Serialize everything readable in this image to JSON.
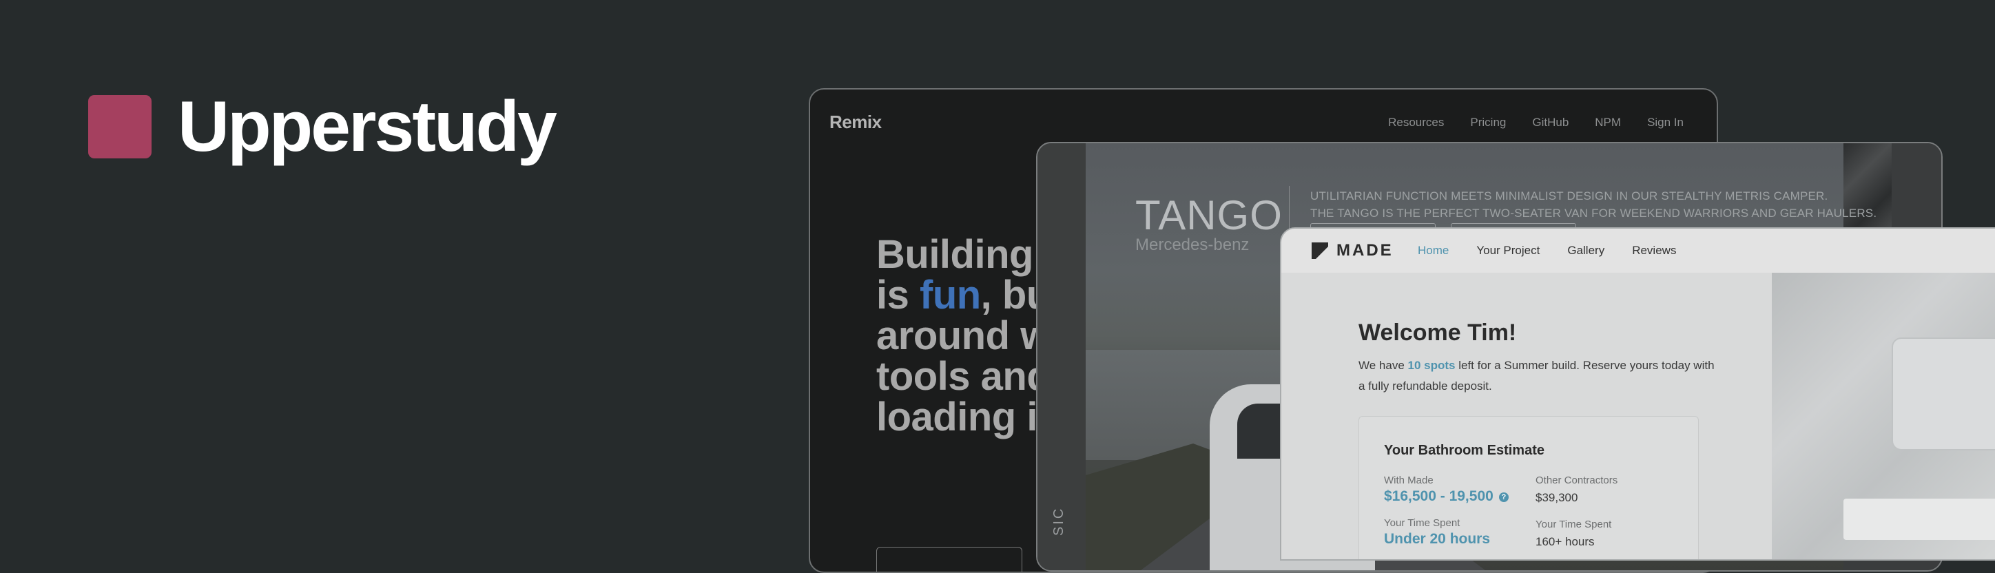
{
  "brand": {
    "name": "Upperstudy",
    "logo_color": "#a5405f"
  },
  "remix": {
    "logo": "Remix",
    "nav": [
      "Resources",
      "Pricing",
      "GitHub",
      "NPM",
      "Sign In"
    ],
    "headline": {
      "line1": "Building",
      "line2_pre": "is ",
      "line2_accent": "fun",
      "line2_post": ", bu",
      "line3": "around w",
      "line4": "tools and",
      "line5": "loading i"
    },
    "accent_color": "#3f72b9"
  },
  "tango": {
    "title": "TANGO",
    "subtitle": "Mercedes-benz",
    "desc_line1": "UTILITARIAN FUNCTION MEETS MINIMALIST DESIGN IN OUR STEALTHY METRIS CAMPER.",
    "desc_line2": "THE TANGO IS THE PERFECT TWO-SEATER VAN FOR WEEKEND WARRIORS AND GEAR HAULERS.",
    "vertical_text": "SIC"
  },
  "made": {
    "logo": "MADE",
    "nav": {
      "home": "Home",
      "project": "Your Project",
      "gallery": "Gallery",
      "reviews": "Reviews"
    },
    "welcome": "Welcome Tim!",
    "text_pre": "We have ",
    "text_accent": "10 spots",
    "text_post": " left for a Summer build. Reserve yours today with a fully refundable deposit.",
    "estimate": {
      "title": "Your Bathroom Estimate",
      "with_made_label": "With Made",
      "with_made_value": "$16,500 - 19,500",
      "other_label": "Other Contractors",
      "other_value": "$39,300",
      "time_label_made": "Your Time Spent",
      "time_value_made": "Under 20 hours",
      "time_label_other": "Your Time Spent",
      "time_value_other": "160+ hours"
    },
    "accent_color": "#4f93ae"
  }
}
